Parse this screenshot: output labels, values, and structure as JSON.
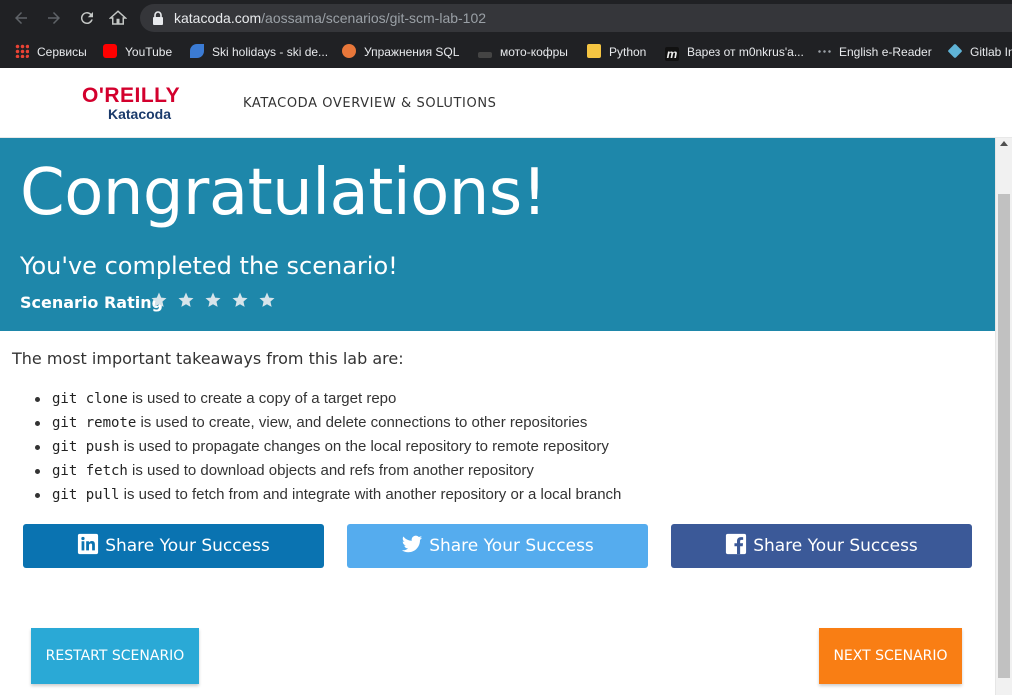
{
  "browser": {
    "url_host": "katacoda.com",
    "url_path": "/aossama/scenarios/git-scm-lab-102",
    "bookmarks": [
      {
        "label": "Сервисы",
        "icon": "apps-grid-icon"
      },
      {
        "label": "YouTube",
        "icon": "youtube-icon"
      },
      {
        "label": "Ski holidays - ski de...",
        "icon": "ski-icon"
      },
      {
        "label": "Упражнения SQL",
        "icon": "sql-icon"
      },
      {
        "label": "мото-кофры",
        "icon": "moto-icon"
      },
      {
        "label": "Python",
        "icon": "folder-icon"
      },
      {
        "label": "Варез от m0nkrus'a...",
        "icon": "m-icon"
      },
      {
        "label": "English e-Reader",
        "icon": "dots-icon"
      },
      {
        "label": "Gitlab In",
        "icon": "gitlab-icon"
      }
    ]
  },
  "header": {
    "logo_top": "O'REILLY",
    "logo_bottom": "Katacoda",
    "nav_link": "KATACODA OVERVIEW & SOLUTIONS"
  },
  "banner": {
    "title": "Congratulations!",
    "subtitle": "You've completed the scenario!",
    "rating_label": "Scenario Rating",
    "rating_stars": 5
  },
  "content": {
    "intro": "The most important takeaways from this lab are:",
    "takeaways": [
      {
        "code": "git clone",
        "text": " is used to create a copy of a target repo"
      },
      {
        "code": "git remote",
        "text": " is used to create, view, and delete connections to other repositories"
      },
      {
        "code": "git push",
        "text": " is used to propagate changes on the local repository to remote repository"
      },
      {
        "code": "git fetch",
        "text": " is used to download objects and refs from another repository"
      },
      {
        "code": "git pull",
        "text": " is used to fetch from and integrate with another repository or a local branch"
      }
    ]
  },
  "share": {
    "linkedin_label": "Share Your Success",
    "twitter_label": "Share Your Success",
    "facebook_label": "Share Your Success"
  },
  "actions": {
    "restart_label": "RESTART SCENARIO",
    "next_label": "NEXT SCENARIO"
  },
  "colors": {
    "banner": "#1e87aa",
    "linkedin": "#0a73b1",
    "twitter": "#55acee",
    "facebook": "#3b5998",
    "restart": "#2aa9d6",
    "next": "#f97e14"
  }
}
